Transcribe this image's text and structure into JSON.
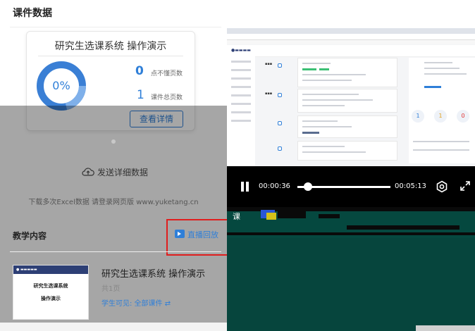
{
  "header": {
    "title": "课件数据"
  },
  "summary_card": {
    "title": "研究生选课系统 操作演示",
    "percent": "0%",
    "progress_fraction": 0,
    "unclear_pages_count": "0",
    "unclear_pages_label": "点不懂页数",
    "total_pages_count": "1",
    "total_pages_label": "课件总页数",
    "details_button": "查看详情"
  },
  "send_data": {
    "label": "发送详细数据",
    "hint": "下载多次Excel数据 请登录网页版 www.yuketang.cn"
  },
  "teaching_content": {
    "title": "教学内容",
    "replay_label": "直播回放",
    "items": [
      {
        "thumb_line1": "研究生选课系统",
        "thumb_line2": "操作演示",
        "title": "研究生选课系统 操作演示",
        "pages": "共1页",
        "visibility": "学生可见: 全部课件 ⇄"
      }
    ]
  },
  "video_player": {
    "current_time": "00:00:36",
    "total_time": "00:05:13",
    "progress_fraction": 0.115,
    "garbled_caption": "课"
  },
  "colors": {
    "accent": "#2f7fd8",
    "highlight_box": "#e01e1e",
    "player_bg": "#000000",
    "garble_bg": "#06453d"
  }
}
